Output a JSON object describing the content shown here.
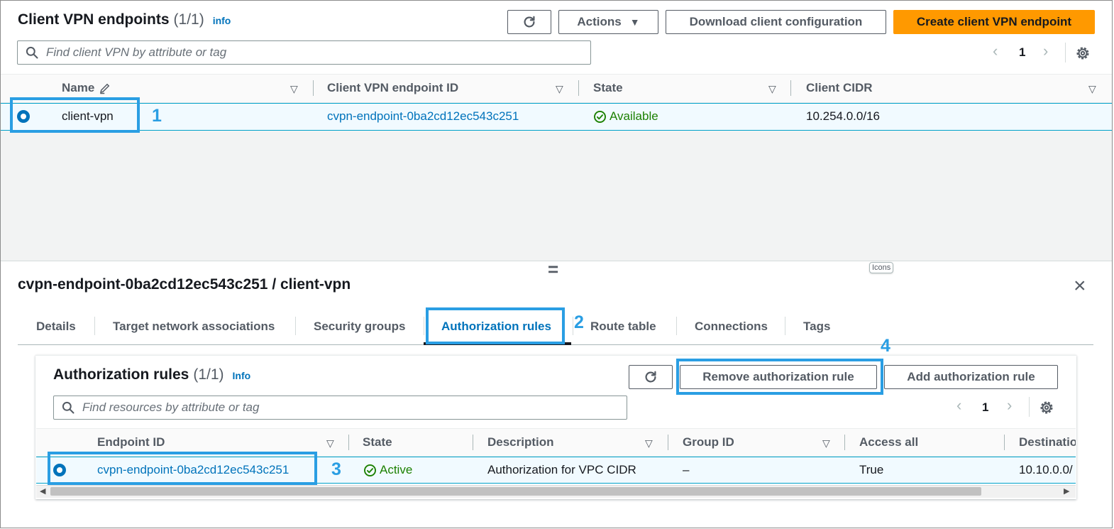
{
  "top": {
    "title": "Client VPN endpoints",
    "count": "(1/1)",
    "info": "info",
    "buttons": {
      "actions": "Actions",
      "download": "Download client configuration",
      "create": "Create client VPN endpoint"
    },
    "search_placeholder": "Find client VPN by attribute or tag",
    "page": "1",
    "columns": [
      "Name",
      "Client VPN endpoint ID",
      "State",
      "Client CIDR"
    ],
    "row": {
      "name": "client-vpn",
      "endpoint_id": "cvpn-endpoint-0ba2cd12ec543c251",
      "state": "Available",
      "client_cidr": "10.254.0.0/16"
    }
  },
  "splitter": {
    "handle": "=",
    "tooltip": "Icons"
  },
  "detail": {
    "title": "cvpn-endpoint-0ba2cd12ec543c251 / client-vpn",
    "tabs": [
      "Details",
      "Target network associations",
      "Security groups",
      "Authorization rules",
      "Route table",
      "Connections",
      "Tags"
    ],
    "active_tab": "Authorization rules"
  },
  "auth": {
    "title": "Authorization rules",
    "count": "(1/1)",
    "info": "Info",
    "buttons": {
      "remove": "Remove authorization rule",
      "add": "Add authorization rule"
    },
    "search_placeholder": "Find resources by attribute or tag",
    "page": "1",
    "columns": [
      "Endpoint ID",
      "State",
      "Description",
      "Group ID",
      "Access all",
      "Destinatio"
    ],
    "row": {
      "endpoint_id": "cvpn-endpoint-0ba2cd12ec543c251",
      "state": "Active",
      "description": "Authorization for VPC CIDR",
      "group_id": "–",
      "access_all": "True",
      "destination": "10.10.0.0/"
    }
  },
  "callouts": [
    "1",
    "2",
    "3",
    "4"
  ],
  "colors": {
    "primary_orange": "#ff9900",
    "link_blue": "#0073bb",
    "success_green": "#1d8102",
    "callout_blue": "#2a9ee3"
  }
}
